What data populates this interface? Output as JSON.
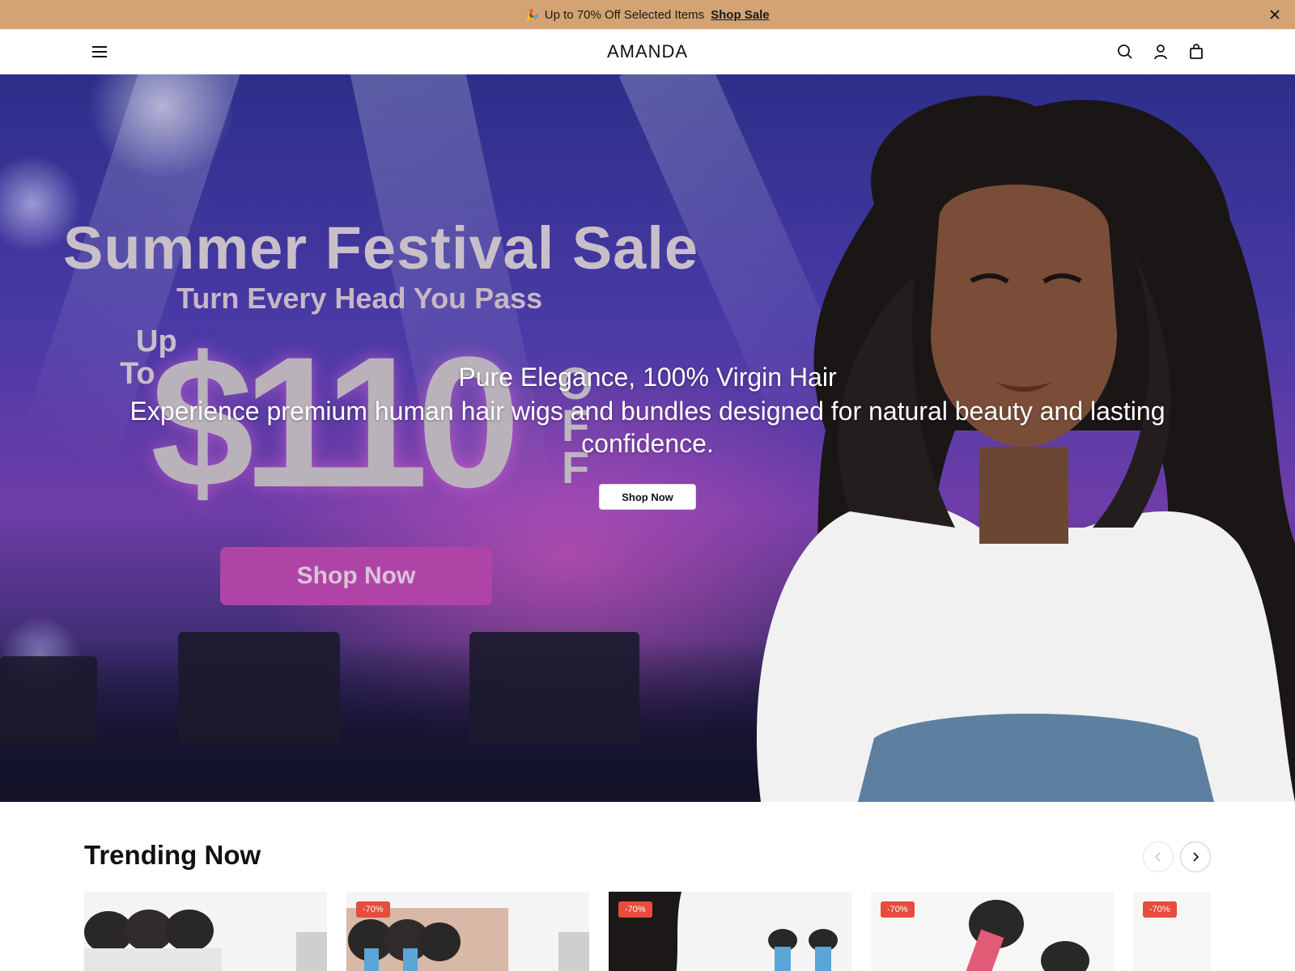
{
  "announcement": {
    "emoji": "🎉",
    "text": "Up to 70% Off Selected Items",
    "link_label": "Shop Sale"
  },
  "header": {
    "logo": "AMANDA",
    "icons": [
      "menu-icon",
      "search-icon",
      "account-icon",
      "bag-icon"
    ]
  },
  "hero": {
    "banner": {
      "title": "Summer Festival Sale",
      "subtitle": "Turn Every Head You Pass",
      "up": "Up",
      "to": "To",
      "amount": "$110",
      "off_o": "O",
      "off_f1": "F",
      "off_f2": "F",
      "button_label": "Shop Now"
    },
    "heading": "Pure Elegance, 100% Virgin Hair",
    "description": "Experience premium human hair wigs and bundles designed for natural beauty and lasting confidence.",
    "cta_label": "Shop Now"
  },
  "trending": {
    "title": "Trending Now",
    "products": [
      {
        "badge": ""
      },
      {
        "badge": "-70%"
      },
      {
        "badge": "-70%"
      },
      {
        "badge": "-70%"
      },
      {
        "badge": "-70%"
      }
    ]
  },
  "colors": {
    "announcement_bg": "#d4a373",
    "badge": "#e74c3c",
    "promo_button": "#b044a6"
  }
}
